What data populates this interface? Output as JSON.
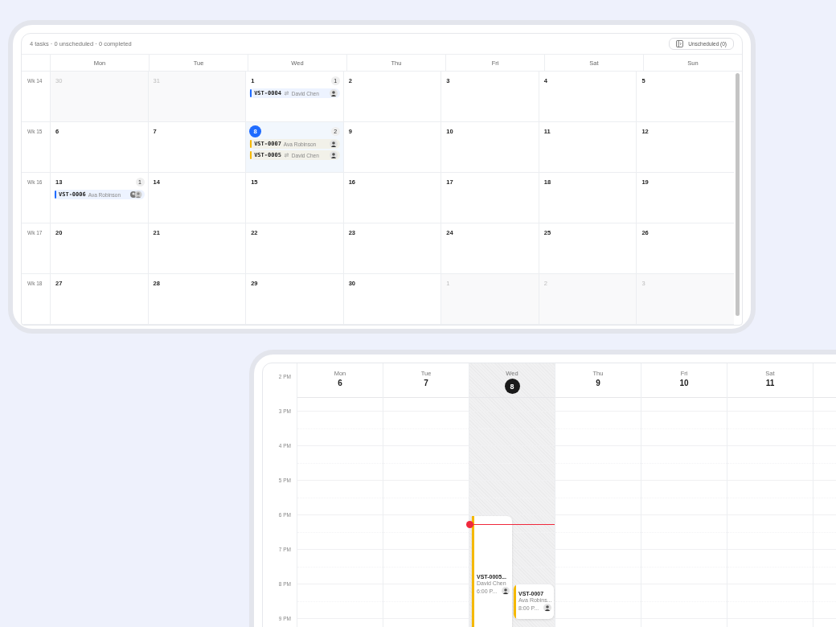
{
  "month_view": {
    "summary": "4 tasks · 0 unscheduled · 0 completed",
    "unscheduled_button": "Unscheduled (0)",
    "weekdays": [
      "Mon",
      "Tue",
      "Wed",
      "Thu",
      "Fri",
      "Sat",
      "Sun"
    ],
    "weeks": [
      {
        "label": "Wk 14",
        "days": [
          {
            "date": "30",
            "muted": true,
            "today": false
          },
          {
            "date": "31",
            "muted": true,
            "today": false
          },
          {
            "date": "1",
            "muted": false,
            "today": false,
            "count": "1",
            "tasks": [
              {
                "id": "VST-0004",
                "assignee": "David Chen",
                "color": "#1f6bff",
                "recurring": true,
                "shared": false
              }
            ]
          },
          {
            "date": "2",
            "muted": false,
            "today": false
          },
          {
            "date": "3",
            "muted": false,
            "today": false
          },
          {
            "date": "4",
            "muted": false,
            "today": false
          },
          {
            "date": "5",
            "muted": false,
            "today": false
          }
        ]
      },
      {
        "label": "Wk 15",
        "days": [
          {
            "date": "6",
            "muted": false,
            "today": false
          },
          {
            "date": "7",
            "muted": false,
            "today": false
          },
          {
            "date": "8",
            "muted": false,
            "today": true,
            "count": "2",
            "tasks": [
              {
                "id": "VST-0007",
                "assignee": "Ava Robinson",
                "color": "#f5b800",
                "recurring": false,
                "shared": false
              },
              {
                "id": "VST-0005",
                "assignee": "David Chen",
                "color": "#f5b800",
                "recurring": true,
                "shared": false
              }
            ]
          },
          {
            "date": "9",
            "muted": false,
            "today": false
          },
          {
            "date": "10",
            "muted": false,
            "today": false
          },
          {
            "date": "11",
            "muted": false,
            "today": false
          },
          {
            "date": "12",
            "muted": false,
            "today": false
          }
        ]
      },
      {
        "label": "Wk 16",
        "days": [
          {
            "date": "13",
            "muted": false,
            "today": false,
            "count": "1",
            "tasks": [
              {
                "id": "VST-0006",
                "assignee": "Ava Robinson",
                "color": "#1f6bff",
                "recurring": false,
                "shared": true
              }
            ]
          },
          {
            "date": "14",
            "muted": false,
            "today": false
          },
          {
            "date": "15",
            "muted": false,
            "today": false
          },
          {
            "date": "16",
            "muted": false,
            "today": false
          },
          {
            "date": "17",
            "muted": false,
            "today": false
          },
          {
            "date": "18",
            "muted": false,
            "today": false
          },
          {
            "date": "19",
            "muted": false,
            "today": false
          }
        ]
      },
      {
        "label": "Wk 17",
        "days": [
          {
            "date": "20",
            "muted": false,
            "today": false
          },
          {
            "date": "21",
            "muted": false,
            "today": false
          },
          {
            "date": "22",
            "muted": false,
            "today": false
          },
          {
            "date": "23",
            "muted": false,
            "today": false
          },
          {
            "date": "24",
            "muted": false,
            "today": false
          },
          {
            "date": "25",
            "muted": false,
            "today": false
          },
          {
            "date": "26",
            "muted": false,
            "today": false
          }
        ]
      },
      {
        "label": "Wk 18",
        "days": [
          {
            "date": "27",
            "muted": false,
            "today": false
          },
          {
            "date": "28",
            "muted": false,
            "today": false
          },
          {
            "date": "29",
            "muted": false,
            "today": false
          },
          {
            "date": "30",
            "muted": false,
            "today": false
          },
          {
            "date": "1",
            "muted": true,
            "today": false
          },
          {
            "date": "2",
            "muted": true,
            "today": false
          },
          {
            "date": "3",
            "muted": true,
            "today": false
          }
        ]
      }
    ]
  },
  "week_view": {
    "hours": [
      "2 PM",
      "3 PM",
      "4 PM",
      "5 PM",
      "6 PM",
      "7 PM",
      "8 PM",
      "9 PM"
    ],
    "days": [
      {
        "name": "Mon",
        "date": "6",
        "selected": false,
        "current_time": false
      },
      {
        "name": "Tue",
        "date": "7",
        "selected": false,
        "current_time": false
      },
      {
        "name": "Wed",
        "date": "8",
        "selected": true,
        "current_time": true,
        "events": [
          {
            "title": "VST-0005...",
            "assignee": "David Chen",
            "time": "6:00 P...",
            "color": "#f5b800"
          },
          {
            "title": "VST-0007",
            "assignee": "Ava Robins...",
            "time": "8:00 P...",
            "color": "#f5b800"
          }
        ]
      },
      {
        "name": "Thu",
        "date": "9",
        "selected": false,
        "current_time": false
      },
      {
        "name": "Fri",
        "date": "10",
        "selected": false,
        "current_time": false
      },
      {
        "name": "Sat",
        "date": "11",
        "selected": false,
        "current_time": false
      }
    ]
  }
}
